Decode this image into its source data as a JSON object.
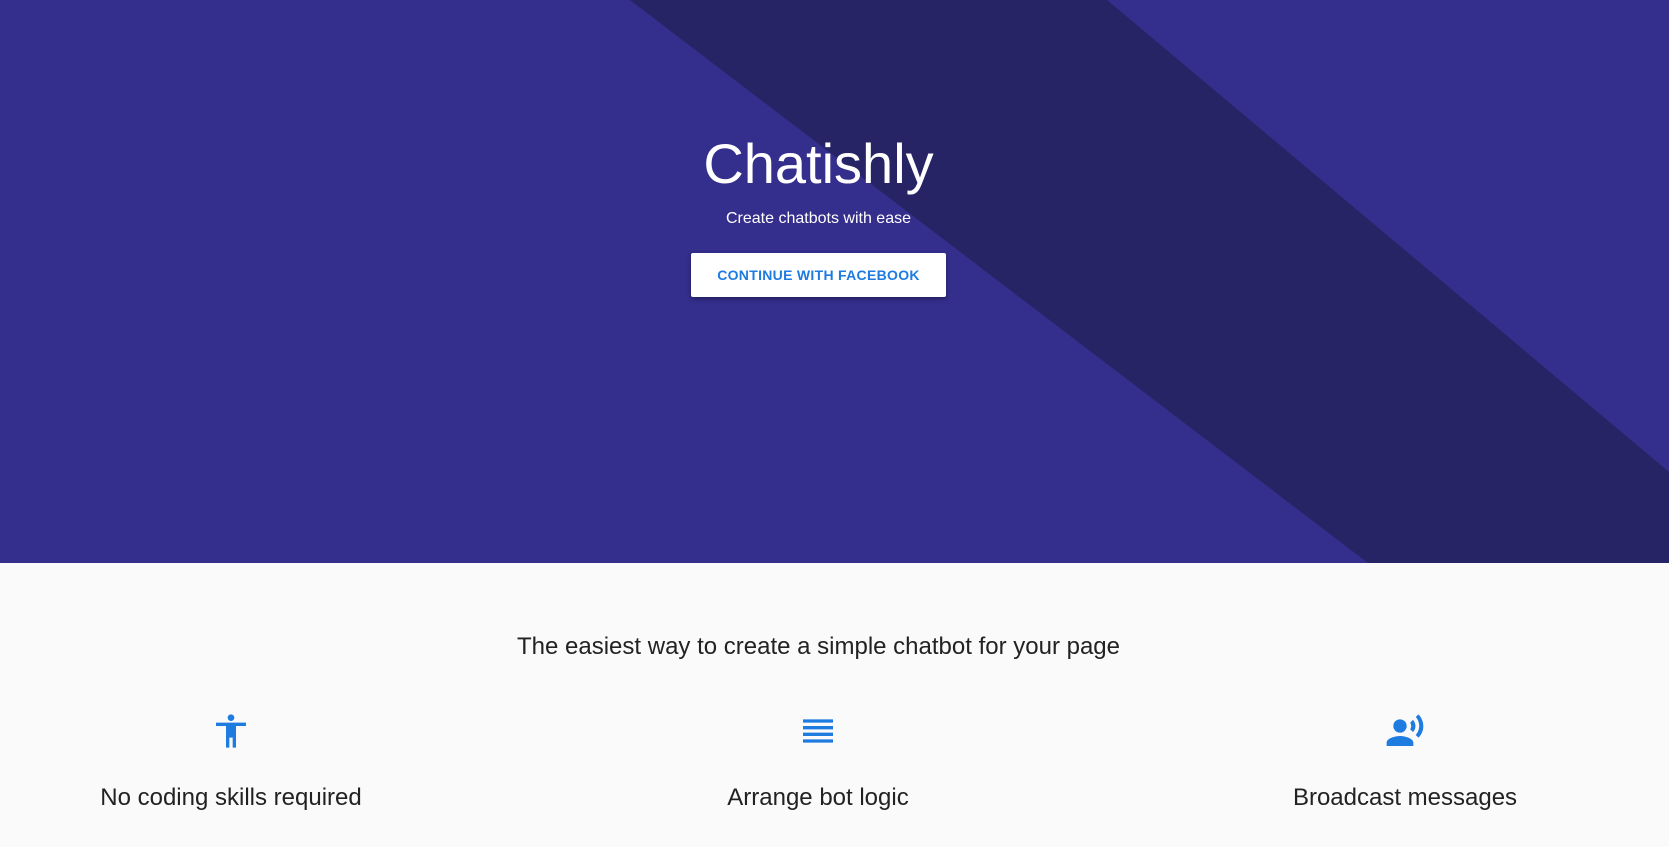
{
  "hero": {
    "title": "Chatishly",
    "tagline": "Create chatbots with ease",
    "cta_label": "CONTINUE WITH FACEBOOK"
  },
  "features": {
    "heading": "The easiest way to create a simple chatbot for your page",
    "items": [
      {
        "icon": "accessibility-icon",
        "title": "No coding skills required"
      },
      {
        "icon": "list-lines-icon",
        "title": "Arrange bot logic"
      },
      {
        "icon": "record-voice-icon",
        "title": "Broadcast messages"
      }
    ]
  },
  "colors": {
    "hero_background": "#342e8c",
    "hero_stripe": "#262464",
    "cta_text": "#1e7be0",
    "icon": "#1e7be0",
    "page_background": "#fafafa",
    "text_dark": "#222222"
  }
}
